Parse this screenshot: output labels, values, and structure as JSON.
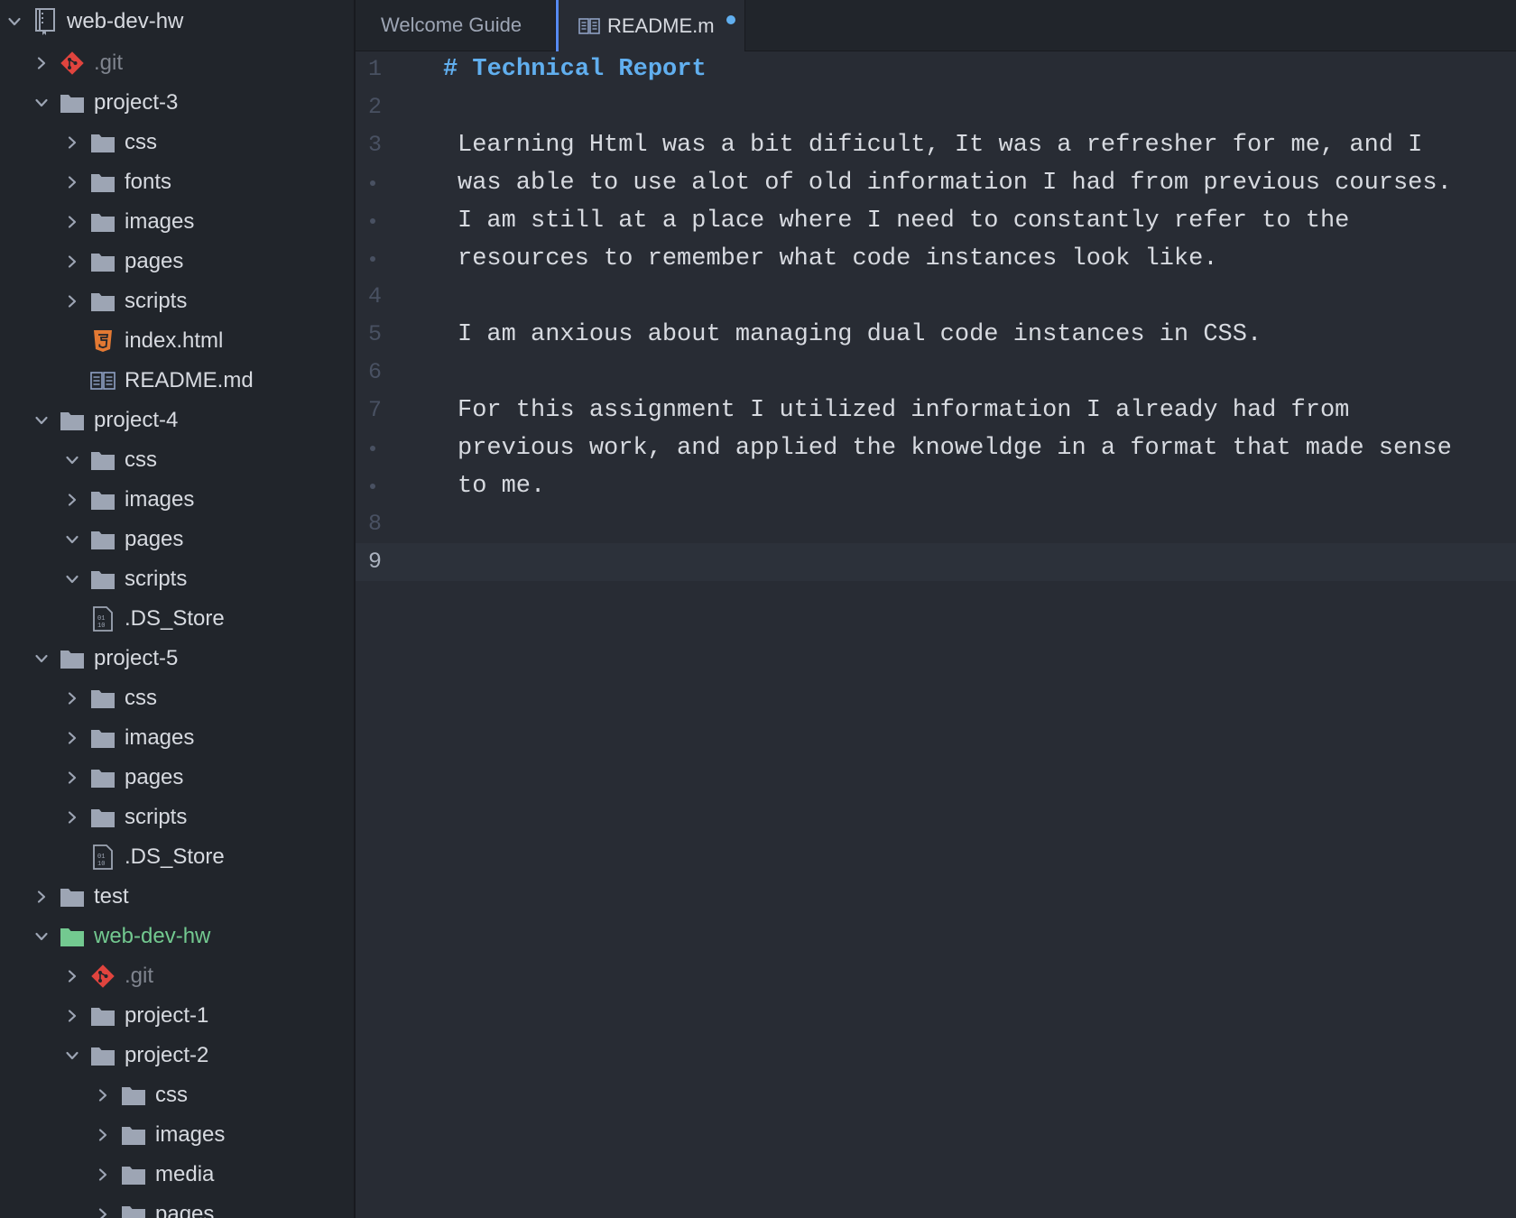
{
  "colors": {
    "sidebar_bg": "#21252b",
    "editor_bg": "#282c34",
    "accent_blue": "#61afef",
    "git_added_green": "#73c990",
    "git_red": "#e0443e",
    "html5_orange": "#e37933"
  },
  "tree": [
    {
      "label": "web-dev-hw",
      "depth": 0,
      "type": "repo",
      "state": "expanded",
      "root": true
    },
    {
      "label": ".git",
      "depth": 1,
      "type": "git",
      "state": "collapsed",
      "status": "ignored"
    },
    {
      "label": "project-3",
      "depth": 1,
      "type": "folder",
      "state": "expanded"
    },
    {
      "label": "css",
      "depth": 2,
      "type": "folder",
      "state": "collapsed"
    },
    {
      "label": "fonts",
      "depth": 2,
      "type": "folder",
      "state": "collapsed"
    },
    {
      "label": "images",
      "depth": 2,
      "type": "folder",
      "state": "collapsed"
    },
    {
      "label": "pages",
      "depth": 2,
      "type": "folder",
      "state": "collapsed"
    },
    {
      "label": "scripts",
      "depth": 2,
      "type": "folder",
      "state": "collapsed"
    },
    {
      "label": "index.html",
      "depth": 2,
      "type": "html5"
    },
    {
      "label": "README.md",
      "depth": 2,
      "type": "markdown"
    },
    {
      "label": "project-4",
      "depth": 1,
      "type": "folder",
      "state": "expanded"
    },
    {
      "label": "css",
      "depth": 2,
      "type": "folder",
      "state": "expanded"
    },
    {
      "label": "images",
      "depth": 2,
      "type": "folder",
      "state": "collapsed"
    },
    {
      "label": "pages",
      "depth": 2,
      "type": "folder",
      "state": "expanded"
    },
    {
      "label": "scripts",
      "depth": 2,
      "type": "folder",
      "state": "expanded"
    },
    {
      "label": ".DS_Store",
      "depth": 2,
      "type": "binary"
    },
    {
      "label": "project-5",
      "depth": 1,
      "type": "folder",
      "state": "expanded"
    },
    {
      "label": "css",
      "depth": 2,
      "type": "folder",
      "state": "collapsed"
    },
    {
      "label": "images",
      "depth": 2,
      "type": "folder",
      "state": "collapsed"
    },
    {
      "label": "pages",
      "depth": 2,
      "type": "folder",
      "state": "collapsed"
    },
    {
      "label": "scripts",
      "depth": 2,
      "type": "folder",
      "state": "collapsed"
    },
    {
      "label": ".DS_Store",
      "depth": 2,
      "type": "binary"
    },
    {
      "label": "test",
      "depth": 1,
      "type": "folder",
      "state": "collapsed"
    },
    {
      "label": "web-dev-hw",
      "depth": 1,
      "type": "folder",
      "state": "expanded",
      "status": "added"
    },
    {
      "label": ".git",
      "depth": 2,
      "type": "git",
      "state": "collapsed",
      "status": "ignored"
    },
    {
      "label": "project-1",
      "depth": 2,
      "type": "folder",
      "state": "collapsed"
    },
    {
      "label": "project-2",
      "depth": 2,
      "type": "folder",
      "state": "expanded"
    },
    {
      "label": "css",
      "depth": 3,
      "type": "folder",
      "state": "collapsed"
    },
    {
      "label": "images",
      "depth": 3,
      "type": "folder",
      "state": "collapsed"
    },
    {
      "label": "media",
      "depth": 3,
      "type": "folder",
      "state": "collapsed"
    },
    {
      "label": "pages",
      "depth": 3,
      "type": "folder",
      "state": "collapsed"
    }
  ],
  "tabs": {
    "welcome": "Welcome Guide",
    "readme": "README.md"
  },
  "editor": {
    "lines": [
      {
        "num": "1",
        "heading": true,
        "hash": "#",
        "text": "Technical Report"
      },
      {
        "num": "2",
        "text": ""
      },
      {
        "num": "3",
        "text": "Learning Html was a bit dificult, It was a refresher for me, and I"
      },
      {
        "num": "",
        "wrap": true,
        "text": "was able to use alot of old information I had from previous courses."
      },
      {
        "num": "",
        "wrap": true,
        "text": "I am still at a place where I need to constantly refer to the"
      },
      {
        "num": "",
        "wrap": true,
        "text": "resources to remember what code instances look like."
      },
      {
        "num": "4",
        "text": ""
      },
      {
        "num": "5",
        "text": "I am anxious about managing dual code instances in CSS."
      },
      {
        "num": "6",
        "text": ""
      },
      {
        "num": "7",
        "text": "For this assignment I utilized information I already had from"
      },
      {
        "num": "",
        "wrap": true,
        "text": "previous work, and applied the knoweldge in a format that made sense"
      },
      {
        "num": "",
        "wrap": true,
        "text": "to me."
      },
      {
        "num": "8",
        "text": ""
      },
      {
        "num": "9",
        "text": "",
        "cursor": true
      }
    ]
  }
}
